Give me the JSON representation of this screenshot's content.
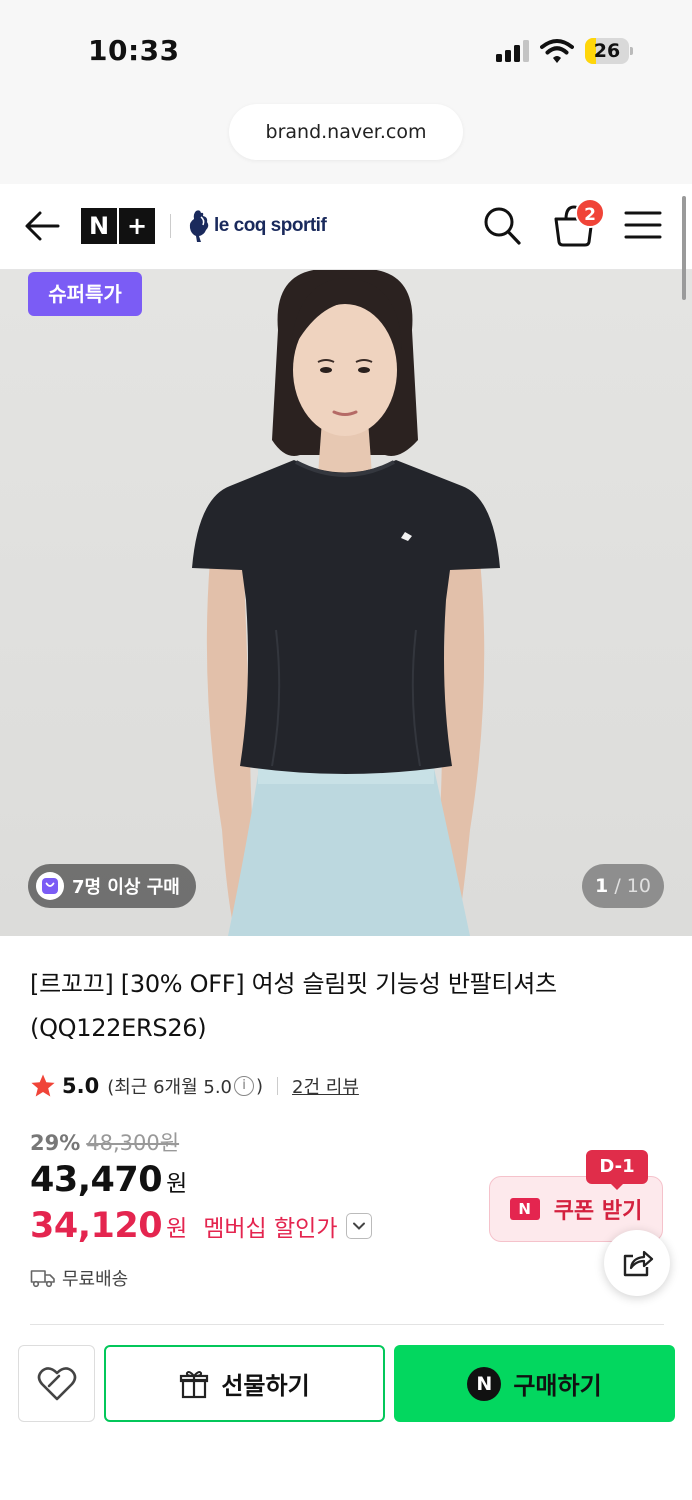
{
  "status_bar": {
    "time": "10:33",
    "battery": "26",
    "battery_level": 0.26
  },
  "browser": {
    "url": "brand.naver.com"
  },
  "header": {
    "store_badge": [
      "N",
      "+"
    ],
    "brand_name": "le coq sportif",
    "cart_count": "2",
    "icons": [
      "back-arrow-icon",
      "search-icon",
      "cart-icon",
      "menu-icon"
    ]
  },
  "image": {
    "promo_badge": "슈퍼특가",
    "group_buy_badge": "7명 이상 구매",
    "counter_current": "1",
    "counter_total": "/ 10"
  },
  "product": {
    "title": "[르꼬끄] [30% OFF] 여성 슬림핏 기능성 반팔티셔츠 (QQ122ERS26)",
    "rating": "5.0",
    "rating_detail_prefix": "(최근 6개월 5.0",
    "rating_detail_info": "i",
    "rating_detail_suffix": ")",
    "review_link": "2건 리뷰",
    "discount_percent": "29%",
    "original_price": "48,300원",
    "price": "43,470",
    "price_unit": "원",
    "member_price": "34,120",
    "member_unit": "원",
    "member_label": "멤버십 할인가",
    "delivery": "무료배송"
  },
  "coupon": {
    "dday": "D-1",
    "badge": "N",
    "label": "쿠폰 받기"
  },
  "actions": {
    "gift_label": "선물하기",
    "buy_badge": "N",
    "buy_label": "구매하기"
  },
  "colors": {
    "accent_green": "#03d75f",
    "member_red": "#e4254f",
    "promo_purple": "#7b5cf5",
    "coupon_bg": "#fde9ec"
  }
}
